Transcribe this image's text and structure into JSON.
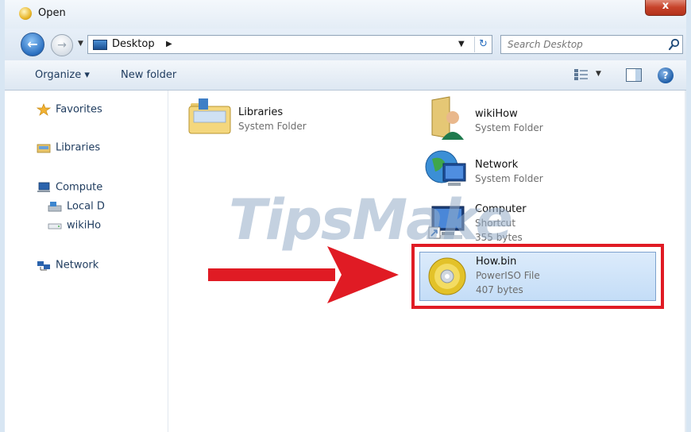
{
  "window": {
    "title": "Open",
    "close_label": "x"
  },
  "address": {
    "location": "Desktop",
    "search_placeholder": "Search Desktop"
  },
  "toolbar": {
    "organize_label": "Organize ▾",
    "new_folder_label": "New folder"
  },
  "nav": {
    "favorites": "Favorites",
    "libraries": "Libraries",
    "computer": "Compute",
    "local_disk": "Local D",
    "wikihow": "wikiHo",
    "network": "Network"
  },
  "items": [
    {
      "name": "Libraries",
      "type": "System Folder",
      "icon": "libraries-folder-icon"
    },
    {
      "name": "wikiHow",
      "type": "System Folder",
      "icon": "user-folder-icon"
    },
    {
      "name": "Network",
      "type": "System Folder",
      "icon": "network-globe-icon"
    },
    {
      "name": "Computer",
      "type": "Shortcut",
      "size": "355 bytes",
      "icon": "computer-icon"
    },
    {
      "name": "How.bin",
      "type": "PowerISO File",
      "size": "407 bytes",
      "icon": "disc-image-icon"
    }
  ],
  "watermark": "TipsMake",
  "colors": {
    "highlight_border": "#e01b24",
    "arrow": "#e01b24",
    "selection_bg": "#cfe3f8"
  }
}
